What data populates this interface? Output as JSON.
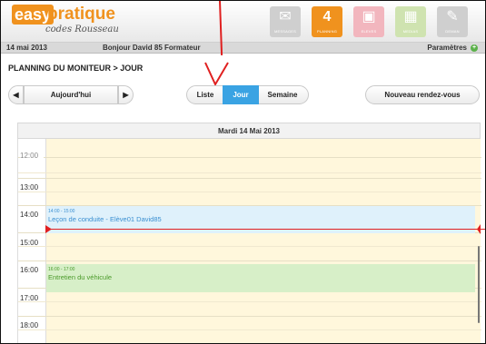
{
  "brand": {
    "logo_main": "easy",
    "logo_accent": "pratique",
    "logo_sub": "codes Rousseau"
  },
  "nav": [
    {
      "label": "MESSAGES",
      "icon": "envelope-icon",
      "glyph": "✉",
      "color": "#c8c8c8",
      "active": false
    },
    {
      "label": "PLANNING",
      "icon": "calendar-icon",
      "glyph": "4",
      "color": "#f0921e",
      "active": true
    },
    {
      "label": "ELEVES",
      "icon": "students-icon",
      "glyph": "▣",
      "color": "#f2b6be",
      "active": false
    },
    {
      "label": "MEDIAS",
      "icon": "image-icon",
      "glyph": "▦",
      "color": "#cfe3b0",
      "active": false
    },
    {
      "label": "DEMAN",
      "icon": "document-icon",
      "glyph": "✎",
      "color": "#c8c8c8",
      "active": false
    }
  ],
  "subbar": {
    "date": "14 mai 2013",
    "greeting": "Bonjour David 85 Formateur",
    "settings_label": "Paramètres"
  },
  "breadcrumb": "PLANNING DU MONITEUR > JOUR",
  "toolbar": {
    "prev_glyph": "◀",
    "today_label": "Aujourd'hui",
    "next_glyph": "▶",
    "view_list": "Liste",
    "view_day": "Jour",
    "view_week": "Semaine",
    "new_appointment": "Nouveau rendez-vous"
  },
  "calendar": {
    "day_header": "Mardi 14 Mai 2013",
    "partial_hour": "12:00",
    "hours": [
      "13:00",
      "14:00",
      "15:00",
      "16:00",
      "17:00",
      "18:00"
    ],
    "events": [
      {
        "time": "14:00 - 15:00",
        "title": "Leçon de conduite - Elève01 David85",
        "bg": "#dff1fb",
        "fg": "#3a8fd1"
      },
      {
        "time": "16:00 - 17:00",
        "title": "Entretien du véhicule",
        "bg": "#d7efc8",
        "fg": "#4a9a2a"
      }
    ]
  },
  "colors": {
    "accent_orange": "#f0921e",
    "active_segment": "#3aa3e3",
    "annotation_red": "#e02020"
  }
}
